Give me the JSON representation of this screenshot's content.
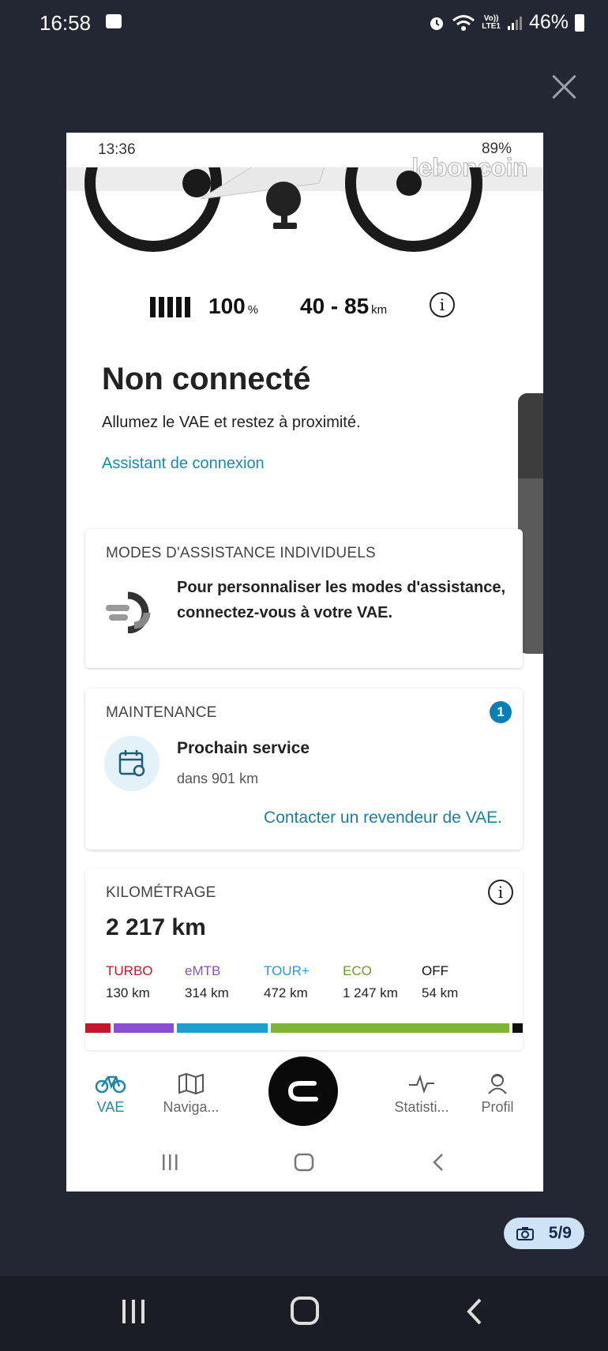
{
  "os_status": {
    "time": "16:58",
    "network": "Vo))\nLTE1",
    "battery": "46%"
  },
  "inner_status": {
    "time": "13:36",
    "battery": "89%",
    "watermark": "leboncoin"
  },
  "battery_row": {
    "level": "100",
    "level_unit": "%",
    "range": "40 - 85",
    "range_unit": "km"
  },
  "header": {
    "title": "Non connecté",
    "subtitle": "Allumez le VAE et restez à proximité.",
    "link": "Assistant de connexion"
  },
  "modes_card": {
    "title": "MODES D'ASSISTANCE INDIVIDUELS",
    "text": "Pour personnaliser les modes d'assistance, connectez-vous à votre VAE."
  },
  "maintenance_card": {
    "title": "MAINTENANCE",
    "badge": "1",
    "service_title": "Prochain service",
    "service_sub": "dans 901 km",
    "link": "Contacter un revendeur de VAE."
  },
  "mileage_card": {
    "title": "KILOMÉTRAGE",
    "total": "2 217 km",
    "modes": [
      {
        "name": "TURBO",
        "value": "130 km",
        "km": 130,
        "color": "#c4162a"
      },
      {
        "name": "eMTB",
        "value": "314 km",
        "km": 314,
        "color": "#8a4fd0"
      },
      {
        "name": "TOUR+",
        "value": "472 km",
        "km": 472,
        "color": "#1d9fce"
      },
      {
        "name": "ECO",
        "value": "1 247 km",
        "km": 1247,
        "color": "#7fb536"
      },
      {
        "name": "OFF",
        "value": "54 km",
        "km": 54,
        "color": "#111111"
      }
    ]
  },
  "bottom_nav": {
    "items": [
      {
        "label": "VAE",
        "icon": "bike-icon",
        "active": true
      },
      {
        "label": "Naviga...",
        "icon": "map-icon",
        "active": false
      },
      {
        "label": "Statisti...",
        "icon": "activity-icon",
        "active": false
      },
      {
        "label": "Profil",
        "icon": "rider-icon",
        "active": false
      }
    ]
  },
  "image_counter": "5/9",
  "colors": {
    "accent": "#1a8aa8",
    "badge": "#0a7fb5",
    "background": "#222733"
  }
}
